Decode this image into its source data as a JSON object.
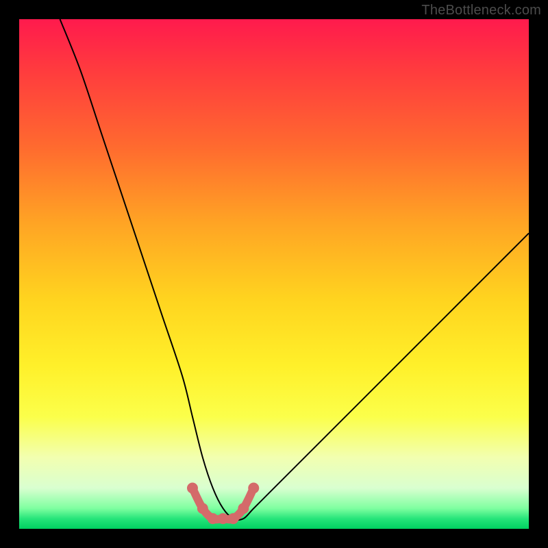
{
  "watermark": "TheBottleneck.com",
  "chart_data": {
    "type": "line",
    "title": "",
    "xlabel": "",
    "ylabel": "",
    "xlim": [
      0,
      100
    ],
    "ylim": [
      0,
      100
    ],
    "series": [
      {
        "name": "bottleneck-curve",
        "x": [
          8,
          12,
          16,
          20,
          24,
          28,
          32,
          34,
          36,
          38,
          40,
          42,
          44,
          46,
          50,
          56,
          64,
          72,
          80,
          88,
          96,
          100
        ],
        "values": [
          100,
          90,
          78,
          66,
          54,
          42,
          30,
          22,
          14,
          8,
          4,
          2,
          2,
          4,
          8,
          14,
          22,
          30,
          38,
          46,
          54,
          58
        ]
      }
    ],
    "highlight": {
      "name": "optimal-range-markers",
      "color": "#d46a6a",
      "x": [
        34,
        36,
        38,
        40,
        42,
        44,
        46
      ],
      "values": [
        8,
        4,
        2,
        2,
        2,
        4,
        8
      ]
    }
  }
}
